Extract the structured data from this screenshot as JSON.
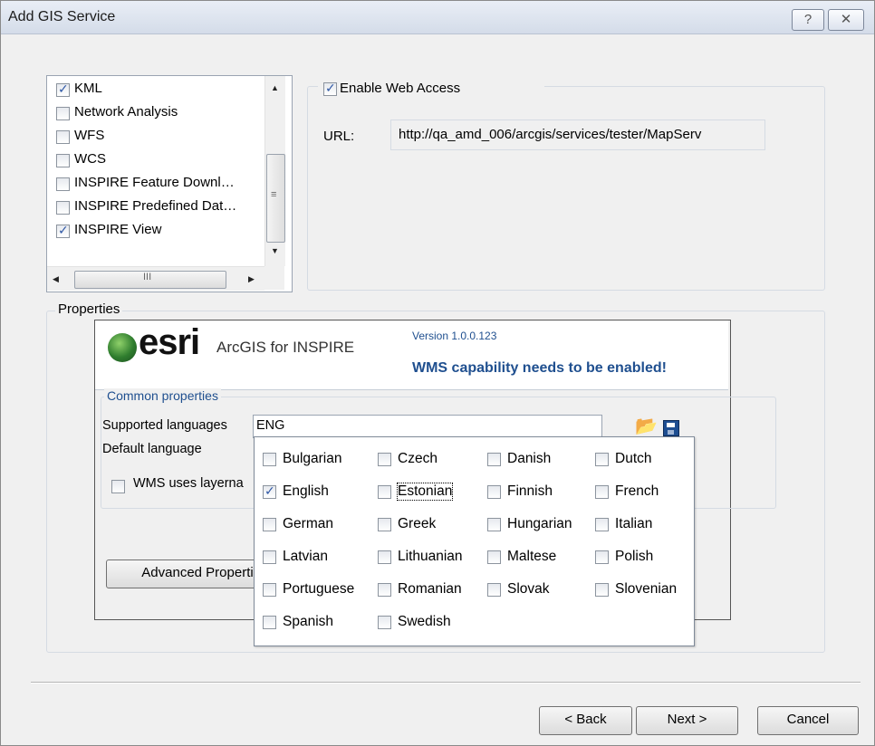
{
  "window": {
    "title": "Add GIS Service",
    "help_glyph": "?",
    "close_glyph": "✕"
  },
  "capabilities": {
    "items": [
      {
        "label": "KML",
        "checked": true
      },
      {
        "label": "Network Analysis",
        "checked": false
      },
      {
        "label": "WFS",
        "checked": false
      },
      {
        "label": "WCS",
        "checked": false
      },
      {
        "label": "INSPIRE Feature Downl…",
        "checked": false
      },
      {
        "label": "INSPIRE Predefined Dat…",
        "checked": false
      },
      {
        "label": "INSPIRE View",
        "checked": true
      }
    ],
    "hscroll_thumb_glyph": "III"
  },
  "web_access": {
    "enable_label": "Enable Web Access",
    "enabled": true,
    "url_label": "URL:",
    "url_value": "http://qa_amd_006/arcgis/services/tester/MapServ"
  },
  "properties": {
    "legend": "Properties",
    "logo_text": "esri",
    "product": "ArcGIS for INSPIRE",
    "version": "Version 1.0.0.123",
    "warning": "WMS capability needs to be enabled!",
    "common_legend": "Common properties",
    "supported_languages_label": "Supported languages",
    "supported_languages_value": "ENG",
    "default_language_label": "Default language",
    "wms_uses_layernames_label": "WMS uses layerna",
    "advanced_button": "Advanced Properti",
    "warning_color": "#1f4f8f"
  },
  "languages": [
    {
      "label": "Bulgarian",
      "checked": false
    },
    {
      "label": "Czech",
      "checked": false
    },
    {
      "label": "Danish",
      "checked": false
    },
    {
      "label": "Dutch",
      "checked": false
    },
    {
      "label": "English",
      "checked": true
    },
    {
      "label": "Estonian",
      "checked": false,
      "focused": true
    },
    {
      "label": "Finnish",
      "checked": false
    },
    {
      "label": "French",
      "checked": false
    },
    {
      "label": "German",
      "checked": false
    },
    {
      "label": "Greek",
      "checked": false
    },
    {
      "label": "Hungarian",
      "checked": false
    },
    {
      "label": "Italian",
      "checked": false
    },
    {
      "label": "Latvian",
      "checked": false
    },
    {
      "label": "Lithuanian",
      "checked": false
    },
    {
      "label": "Maltese",
      "checked": false
    },
    {
      "label": "Polish",
      "checked": false
    },
    {
      "label": "Portuguese",
      "checked": false
    },
    {
      "label": "Romanian",
      "checked": false
    },
    {
      "label": "Slovak",
      "checked": false
    },
    {
      "label": "Slovenian",
      "checked": false
    },
    {
      "label": "Spanish",
      "checked": false
    },
    {
      "label": "Swedish",
      "checked": false
    }
  ],
  "footer": {
    "back_label": "< Back",
    "next_label": "Next >",
    "cancel_label": "Cancel"
  }
}
